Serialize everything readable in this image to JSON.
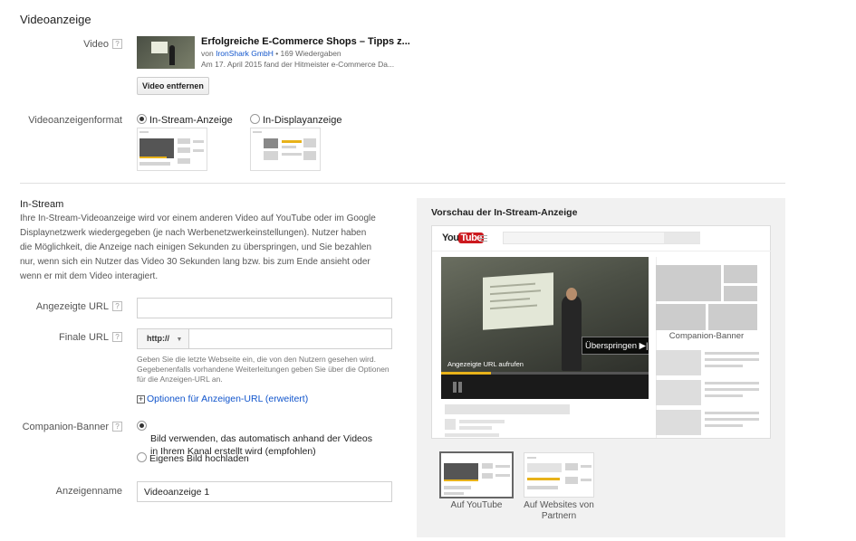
{
  "section_title": "Videoanzeige",
  "video": {
    "label": "Video",
    "help": "?",
    "title": "Erfolgreiche E-Commerce Shops – Tipps z...",
    "by_prefix": "von ",
    "channel": "IronShark GmbH",
    "views": " • 169 Wiedergaben",
    "description": "Am 17. April 2015 fand der Hitmeister e-Commerce Da...",
    "remove_button": "Video entfernen"
  },
  "format": {
    "label": "Videoanzeigenformat",
    "option_instream": "In-Stream-Anzeige",
    "option_display": "In-Displayanzeige",
    "selected": "In-Stream-Anzeige"
  },
  "instream": {
    "heading": "In-Stream",
    "description": "Ihre In-Stream-Videoanzeige wird vor einem anderen Video auf YouTube oder im Google Displaynetzwerk wiedergegeben (je nach Werbenetzwerkeinstellungen). Nutzer haben die Möglichkeit, die Anzeige nach einigen Sekunden zu überspringen, und Sie bezahlen nur, wenn sich ein Nutzer das Video 30 Sekunden lang bzw. bis zum Ende ansieht oder wenn er mit dem Video interagiert."
  },
  "form": {
    "display_url_label": "Angezeigte URL",
    "display_url_value": "",
    "final_url_label": "Finale URL",
    "protocol": "http://",
    "final_url_value": "",
    "final_url_hint": "Geben Sie die letzte Webseite ein, die von den Nutzern gesehen wird. Gegebenenfalls vorhandene Weiterleitungen geben Sie über die Optionen für die Anzeigen-URL an.",
    "advanced_link": "Optionen für Anzeigen-URL (erweitert)",
    "companion_label": "Companion-Banner",
    "companion_auto": "Bild verwenden, das automatisch anhand der Videos in Ihrem Kanal erstellt wird (empfohlen)",
    "companion_upload": "Eigenes Bild hochladen",
    "ad_name_label": "Anzeigenname",
    "ad_name_value": "Videoanzeige 1"
  },
  "preview": {
    "title": "Vorschau der In-Stream-Anzeige",
    "logo_you": "You",
    "logo_tube": "Tube",
    "skip_label": "Überspringen ▶|",
    "visit_label": "Angezeigte URL aufrufen",
    "companion_label": "Companion-Banner",
    "tab_youtube": "Auf YouTube",
    "tab_partners": "Auf Websites von Partnern"
  },
  "colors": {
    "link": "#1155cc",
    "progress": "#e8b21a",
    "youtube_red": "#cc181e"
  }
}
